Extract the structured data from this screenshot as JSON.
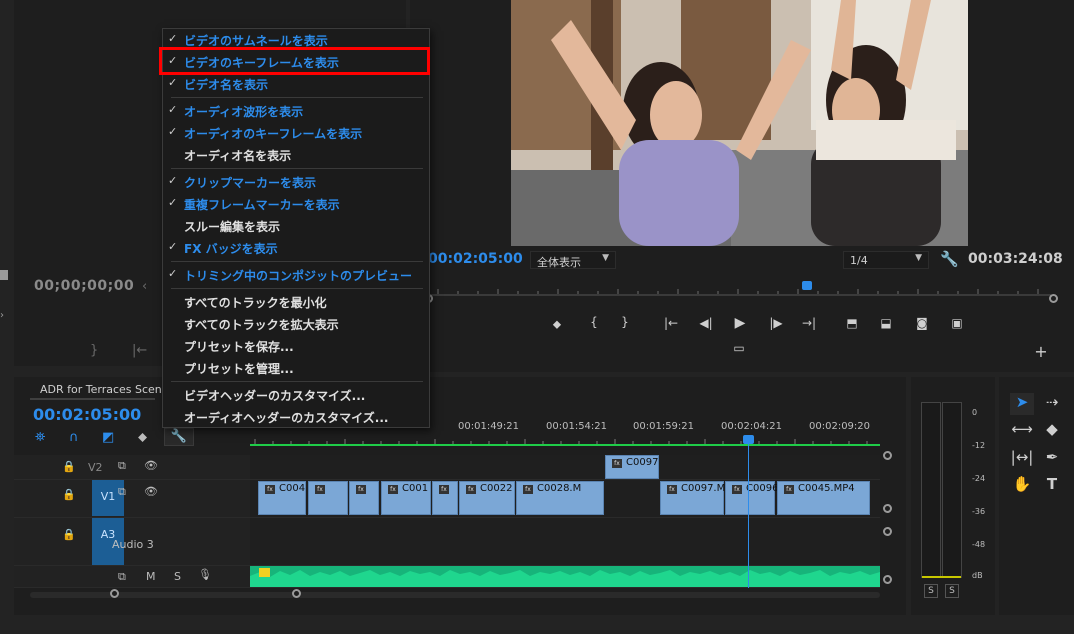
{
  "source_monitor": {
    "timecode": "00;00;00;00"
  },
  "program_monitor": {
    "timecode": "00:02:05:00",
    "zoom_select": "全体表示",
    "resolution_select": "1/4",
    "duration": "00:03:24:08"
  },
  "timeline": {
    "sequence_name": "ADR for Terraces Scene",
    "timecode": "00:02:05:00",
    "ruler_labels": [
      "00:01:49:21",
      "00:01:54:21",
      "00:01:59:21",
      "00:02:04:21",
      "00:02:09:20"
    ],
    "tracks": {
      "v2": {
        "label": "V2"
      },
      "v1": {
        "label": "V1"
      },
      "a3": {
        "label": "A3",
        "name": "Audio 3"
      }
    },
    "clips_v2": [
      {
        "name": "C0097"
      }
    ],
    "clips_v1": [
      {
        "name": "C004"
      },
      {
        "name": ""
      },
      {
        "name": ""
      },
      {
        "name": "C001"
      },
      {
        "name": ""
      },
      {
        "name": "C0022"
      },
      {
        "name": "C0028.M"
      },
      {
        "name": "C0097.M"
      },
      {
        "name": "C0096"
      },
      {
        "name": "C0045.MP4"
      }
    ],
    "audio_buttons": {
      "mute": "M",
      "solo": "S"
    }
  },
  "meter": {
    "db_labels": [
      "0",
      "-12",
      "-24",
      "-36",
      "-48",
      "dB"
    ],
    "solo_left": "S",
    "solo_right": "S"
  },
  "context_menu": {
    "items": [
      {
        "label": "ビデオのサムネールを表示",
        "checked": true
      },
      {
        "label": "ビデオのキーフレームを表示",
        "checked": true
      },
      {
        "label": "ビデオ名を表示",
        "checked": true
      },
      {
        "label": "オーディオ波形を表示",
        "checked": true
      },
      {
        "label": "オーディオのキーフレームを表示",
        "checked": true
      },
      {
        "label": "オーディオ名を表示",
        "checked": false
      },
      {
        "label": "クリップマーカーを表示",
        "checked": true
      },
      {
        "label": "重複フレームマーカーを表示",
        "checked": true
      },
      {
        "label": "スルー編集を表示",
        "checked": false
      },
      {
        "label": "FX バッジを表示",
        "checked": true
      },
      {
        "label": "トリミング中のコンポジットのプレビュー",
        "checked": true
      },
      {
        "label": "すべてのトラックを最小化",
        "checked": false
      },
      {
        "label": "すべてのトラックを拡大表示",
        "checked": false
      },
      {
        "label": "プリセットを保存...",
        "checked": false
      },
      {
        "label": "プリセットを管理...",
        "checked": false
      },
      {
        "label": "ビデオヘッダーのカスタマイズ...",
        "checked": false
      },
      {
        "label": "オーディオヘッダーのカスタマイズ...",
        "checked": false
      }
    ],
    "check_glyph": "✓"
  },
  "colors": {
    "accent": "#2d8ceb",
    "highlight": "#ff0000",
    "clip": "#7ba7d6",
    "audio_wave": "#1fd68e"
  }
}
